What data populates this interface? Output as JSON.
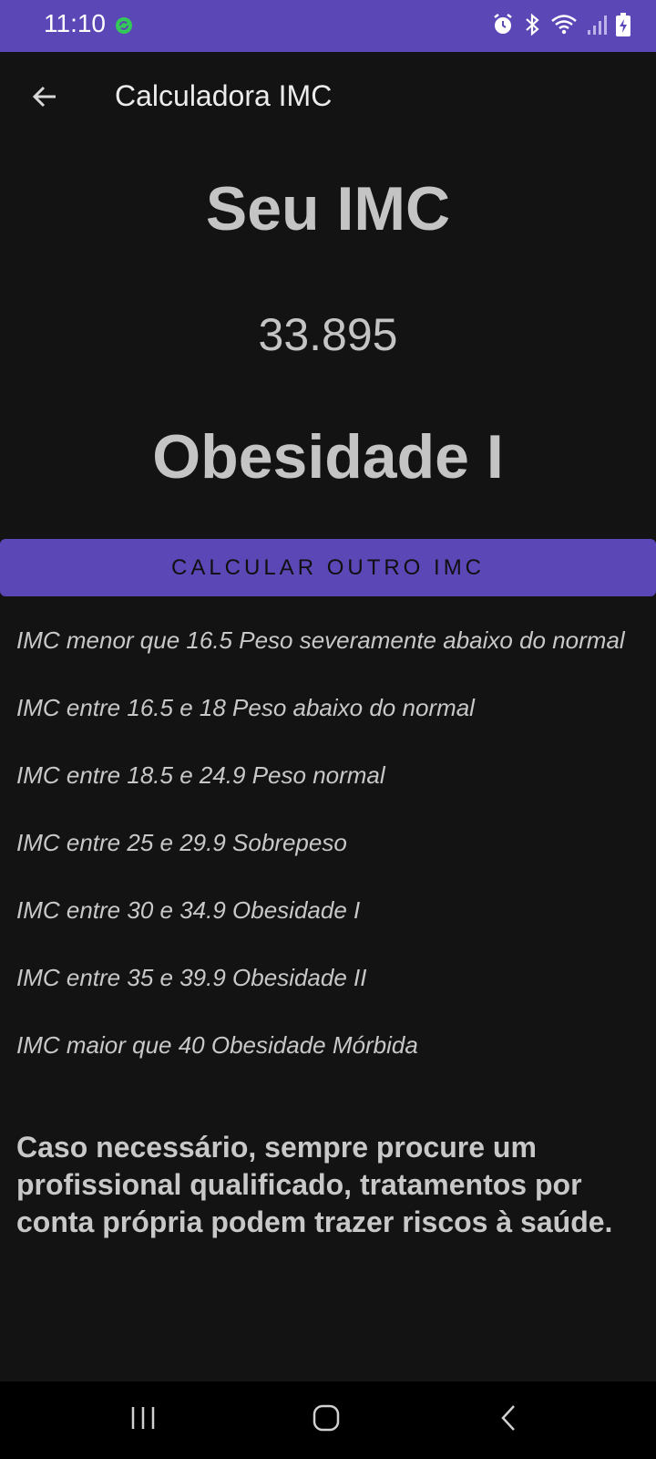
{
  "status_bar": {
    "time": "11:10",
    "icons": [
      "sync-icon",
      "alarm-icon",
      "bluetooth-icon",
      "wifi-icon",
      "signal-icon",
      "battery-charging-icon"
    ]
  },
  "app_bar": {
    "title": "Calculadora IMC",
    "back_icon": "arrow-back-icon"
  },
  "result": {
    "heading": "Seu IMC",
    "value": "33.895",
    "category": "Obesidade I"
  },
  "button": {
    "label": "CALCULAR OUTRO IMC"
  },
  "ranges": [
    "IMC menor que 16.5 Peso severamente abaixo do normal",
    "IMC entre 16.5 e 18 Peso abaixo do normal",
    "IMC entre 18.5 e 24.9 Peso normal",
    "IMC entre 25 e 29.9 Sobrepeso",
    "IMC entre 30 e 34.9 Obesidade I",
    "IMC entre 35 e 39.9 Obesidade II",
    "IMC maior que 40 Obesidade Mórbida"
  ],
  "warning": "Caso necessário, sempre procure um profissional qualificado, tratamentos por conta própria podem trazer riscos à saúde.",
  "nav_bar": {
    "icons": [
      "recents-icon",
      "home-icon",
      "back-icon"
    ]
  },
  "colors": {
    "accent": "#5b47b5",
    "background": "#131313",
    "text": "#c8c8c8"
  }
}
